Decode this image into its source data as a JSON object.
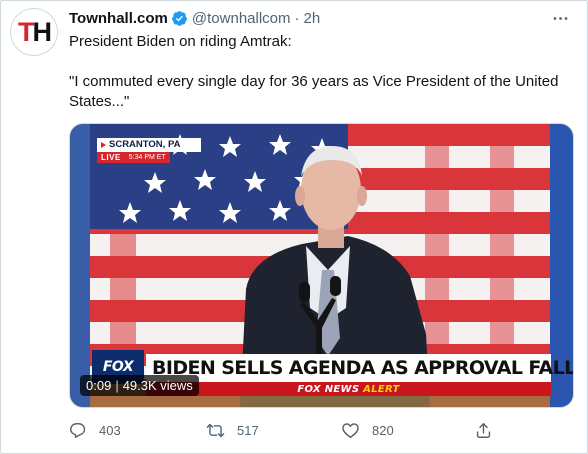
{
  "tweet": {
    "display_name": "Townhall.com",
    "handle": "@townhallcom",
    "separator": "·",
    "time": "2h",
    "avatar_initials": {
      "first": "T",
      "second": "H"
    },
    "text_lines": [
      "President Biden on riding Amtrak:",
      "\"I commuted every single day for 36 years as Vice President of the United States...\""
    ]
  },
  "media": {
    "location_label": "SCRANTON, PA",
    "live_label": "LIVE",
    "live_time": "5:34 PM ET",
    "network_logo": "FOX",
    "headline": "BIDEN SELLS AGENDA AS APPROVAL FALLS",
    "alert_network": "FOX NEWS",
    "alert_word": "ALERT",
    "video_time": "0:09",
    "views": "49.3K views"
  },
  "actions": {
    "reply_count": "403",
    "retweet_count": "517",
    "like_count": "820"
  },
  "icons": {
    "verified": "verified-badge-icon",
    "more": "more-options-icon",
    "reply": "reply-icon",
    "retweet": "retweet-icon",
    "like": "heart-icon",
    "share": "share-icon"
  },
  "colors": {
    "verified_blue": "#1d9bf0",
    "secondary_text": "#536471",
    "fox_red": "#c9151c",
    "fox_blue": "#0b2d6e"
  }
}
